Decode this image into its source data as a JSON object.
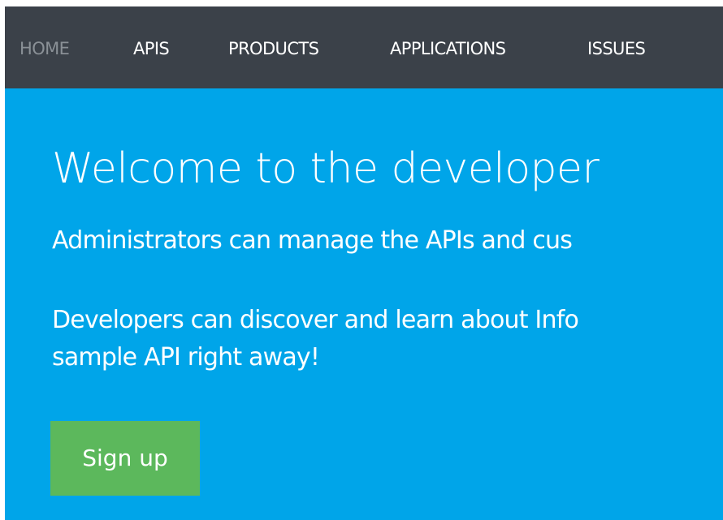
{
  "nav": {
    "items": [
      {
        "label": "HOME",
        "active": true
      },
      {
        "label": "APIS",
        "active": false
      },
      {
        "label": "PRODUCTS",
        "active": false
      },
      {
        "label": "APPLICATIONS",
        "active": false
      },
      {
        "label": "ISSUES",
        "active": false
      }
    ]
  },
  "hero": {
    "title": "Welcome to the developer",
    "paragraph1": "Administrators can manage the APIs and cus",
    "paragraph2_line1": "Developers can discover and learn about Info",
    "paragraph2_line2": "sample API right away!",
    "signup_label": "Sign up"
  },
  "colors": {
    "navbar_bg": "#3b4149",
    "hero_bg": "#00a5e9",
    "button_bg": "#5cb85c",
    "nav_active_text": "#8a9096",
    "text": "#ffffff"
  }
}
